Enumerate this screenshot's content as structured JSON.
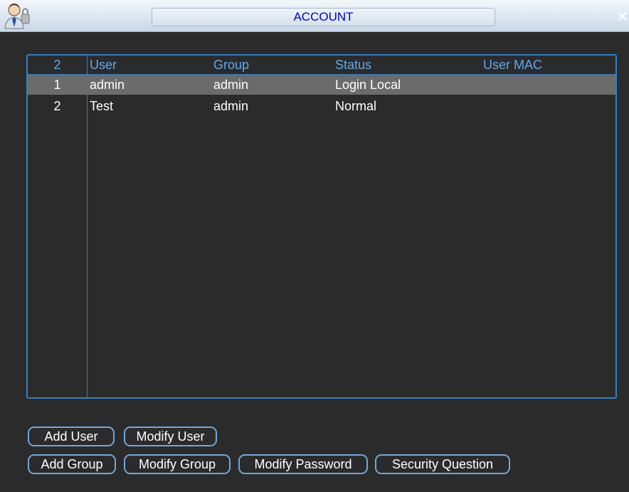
{
  "window": {
    "title": "ACCOUNT"
  },
  "table": {
    "headers": {
      "index": "2",
      "user": "User",
      "group": "Group",
      "status": "Status",
      "mac": "User MAC"
    },
    "rows": [
      {
        "index": "1",
        "user": "admin",
        "group": "admin",
        "status": "Login Local",
        "mac": ""
      },
      {
        "index": "2",
        "user": "Test",
        "group": "admin",
        "status": "Normal",
        "mac": ""
      }
    ],
    "selected_row": 0
  },
  "buttons": {
    "add_user": "Add User",
    "modify_user": "Modify User",
    "add_group": "Add Group",
    "modify_group": "Modify Group",
    "modify_password": "Modify Password",
    "security_question": "Security Question"
  },
  "colors": {
    "accent": "#2f80c9",
    "title_text": "#0000cc",
    "background": "#2b2b2b",
    "selected_row": "#6b6b6b"
  },
  "icons": {
    "title": "user-lock-icon",
    "close": "close-icon"
  }
}
